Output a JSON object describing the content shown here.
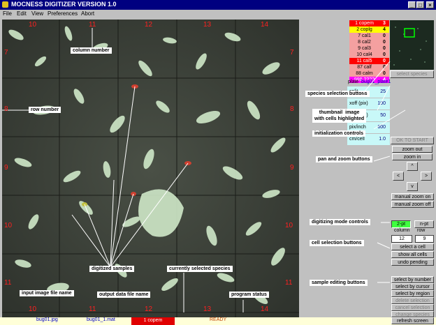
{
  "window": {
    "title": "MOCNESS DIGITIZER VERSION 1.0"
  },
  "menu": [
    "File",
    "Edit",
    "View",
    "Preferences",
    "Abort"
  ],
  "grid": {
    "columns_top": [
      "10",
      "11",
      "12",
      "13",
      "14"
    ],
    "rows_left": [
      "7",
      "8",
      "9",
      "10",
      "11"
    ],
    "rows_right": [
      "7",
      "8",
      "9",
      "10",
      "11"
    ],
    "columns_bottom": [
      "10",
      "11",
      "12",
      "13",
      "14"
    ]
  },
  "callouts": {
    "column_number": "column number",
    "row_number": "row number",
    "digitized_samples": "digitized samples",
    "currently_selected_species": "currently selected species",
    "input_image_file_name": "input image file name",
    "output_data_file_name": "output data file name",
    "program_status": "program status",
    "species_selection_buttons": "species selection buttons",
    "thumbnail_image": "thumbnail  image\nwith cells highlighted",
    "initialization_controls": "initialization controls",
    "pan_and_zoom_buttons": "pan and zoom buttons",
    "digitizing_mode_controls": "digitizing mode controls",
    "cell_selection_buttons": "cell selection buttons",
    "sample_editing_buttons": "sample editing buttons"
  },
  "species": [
    {
      "name": "1 copem",
      "count": "3",
      "bg": "#ff0000",
      "fg": "#ffffff"
    },
    {
      "name": "2 coplg",
      "count": "4",
      "bg": "#ffff00",
      "fg": "#000000"
    },
    {
      "name": "7 cal1",
      "count": "0",
      "bg": "#f4a0a0",
      "fg": "#000000"
    },
    {
      "name": "8 cal2",
      "count": "0",
      "bg": "#f4a0a0",
      "fg": "#000000"
    },
    {
      "name": "9 cal3",
      "count": "0",
      "bg": "#f4a0a0",
      "fg": "#000000"
    },
    {
      "name": "10 cal4",
      "count": "0",
      "bg": "#f4a0a0",
      "fg": "#000000"
    },
    {
      "name": "11 cal5",
      "count": "0",
      "bg": "#ff0000",
      "fg": "#ffffff"
    },
    {
      "name": "87 calf",
      "count": "0",
      "bg": "#f4a0a0",
      "fg": "#000000"
    },
    {
      "name": "88 calm",
      "count": "0",
      "bg": "#f4a0a0",
      "fg": "#000000"
    },
    {
      "name": "999 ????",
      "count": "4",
      "bg": "#ff00ff",
      "fg": "#ffffff"
    }
  ],
  "select_species_button": "select species",
  "init": {
    "plate_label": "plate",
    "plate_value": "bug01_plate1",
    "rows": [
      {
        "label": "split",
        "value": "25"
      },
      {
        "label": "xoff (pix)",
        "value": "100"
      },
      {
        "label": "yoff (pix)",
        "value": "50"
      },
      {
        "label": "pix/inch",
        "value": "600"
      },
      {
        "label": "cm/cell",
        "value": "1.0"
      }
    ],
    "ok_button": "OK TO START"
  },
  "pan_zoom": {
    "zoom_out": "zoom out",
    "zoom_in": "zoom in",
    "up": "^",
    "left": "<",
    "right": ">",
    "down": "v",
    "manual_zoom_on": "manual zoom on",
    "manual_zoom_off": "manual zoom off"
  },
  "mode": {
    "two_pt": "2-pt",
    "n_pt": "n-pt"
  },
  "cell": {
    "column_label": "column",
    "row_label": "row",
    "column_value": "12",
    "row_value": "9",
    "select_cell": "select a cell",
    "show_all_cells": "show all cells",
    "undo_pending": "undo pending"
  },
  "edit": {
    "select_by_number": "select by number",
    "select_by_cursor": "select by cursor",
    "select_by_region": "select by region",
    "delete_selection": "delete selection",
    "cancel_selection": "cancel selection",
    "change_species": "change species",
    "refresh_screen": "refresh screen"
  },
  "status": {
    "input_file": "bug01.jpg",
    "output_file": "bug01_1.mat",
    "current_species": "1 copem",
    "program_status": "READY"
  },
  "colors": {
    "title_bar": "#000080",
    "panel": "#c0c0c0",
    "config_bg": "#c8f8f8",
    "status_bg": "#ffffd8"
  }
}
